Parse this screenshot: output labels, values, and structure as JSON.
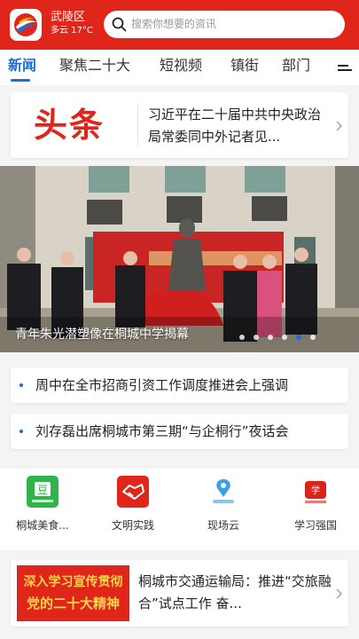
{
  "header": {
    "district": "武陵区",
    "weather": "多云 17°C",
    "search_placeholder": "搜索你想要的资讯",
    "colors": {
      "brand_red": "#e0251b",
      "accent_blue": "#1a6fd6"
    }
  },
  "tabs": [
    {
      "label": "新闻",
      "active": true
    },
    {
      "label": "聚焦二十大",
      "active": false
    },
    {
      "label": "短视频",
      "active": false
    },
    {
      "label": "镇街",
      "active": false
    },
    {
      "label": "部门",
      "active": false
    }
  ],
  "menu_icon": "menu-icon",
  "headline": {
    "tag": "头条",
    "title": "习近平在二十届中共中央政治局常委同中外记者见..."
  },
  "banner": {
    "caption": "青年朱光潜塑像在桐城中学揭幕",
    "slide_count": 6,
    "active_slide": 5
  },
  "news": [
    {
      "text": "周中在全市招商引资工作调度推进会上强调"
    },
    {
      "text": "刘存磊出席桐城市第三期“与企桐行”夜话会"
    }
  ],
  "quick_links": [
    {
      "label": "桐城美食...",
      "icon": "food-icon"
    },
    {
      "label": "文明实践",
      "icon": "handshake-icon"
    },
    {
      "label": "现场云",
      "icon": "live-cloud-icon"
    },
    {
      "label": "学习强国",
      "icon": "study-icon"
    }
  ],
  "bottom_card": {
    "promo_line1": "深入学习宣传贯彻",
    "promo_line2": "党的二十大精神",
    "title": "桐城市交通运输局：推进“交旅融合”试点工作 奋..."
  }
}
